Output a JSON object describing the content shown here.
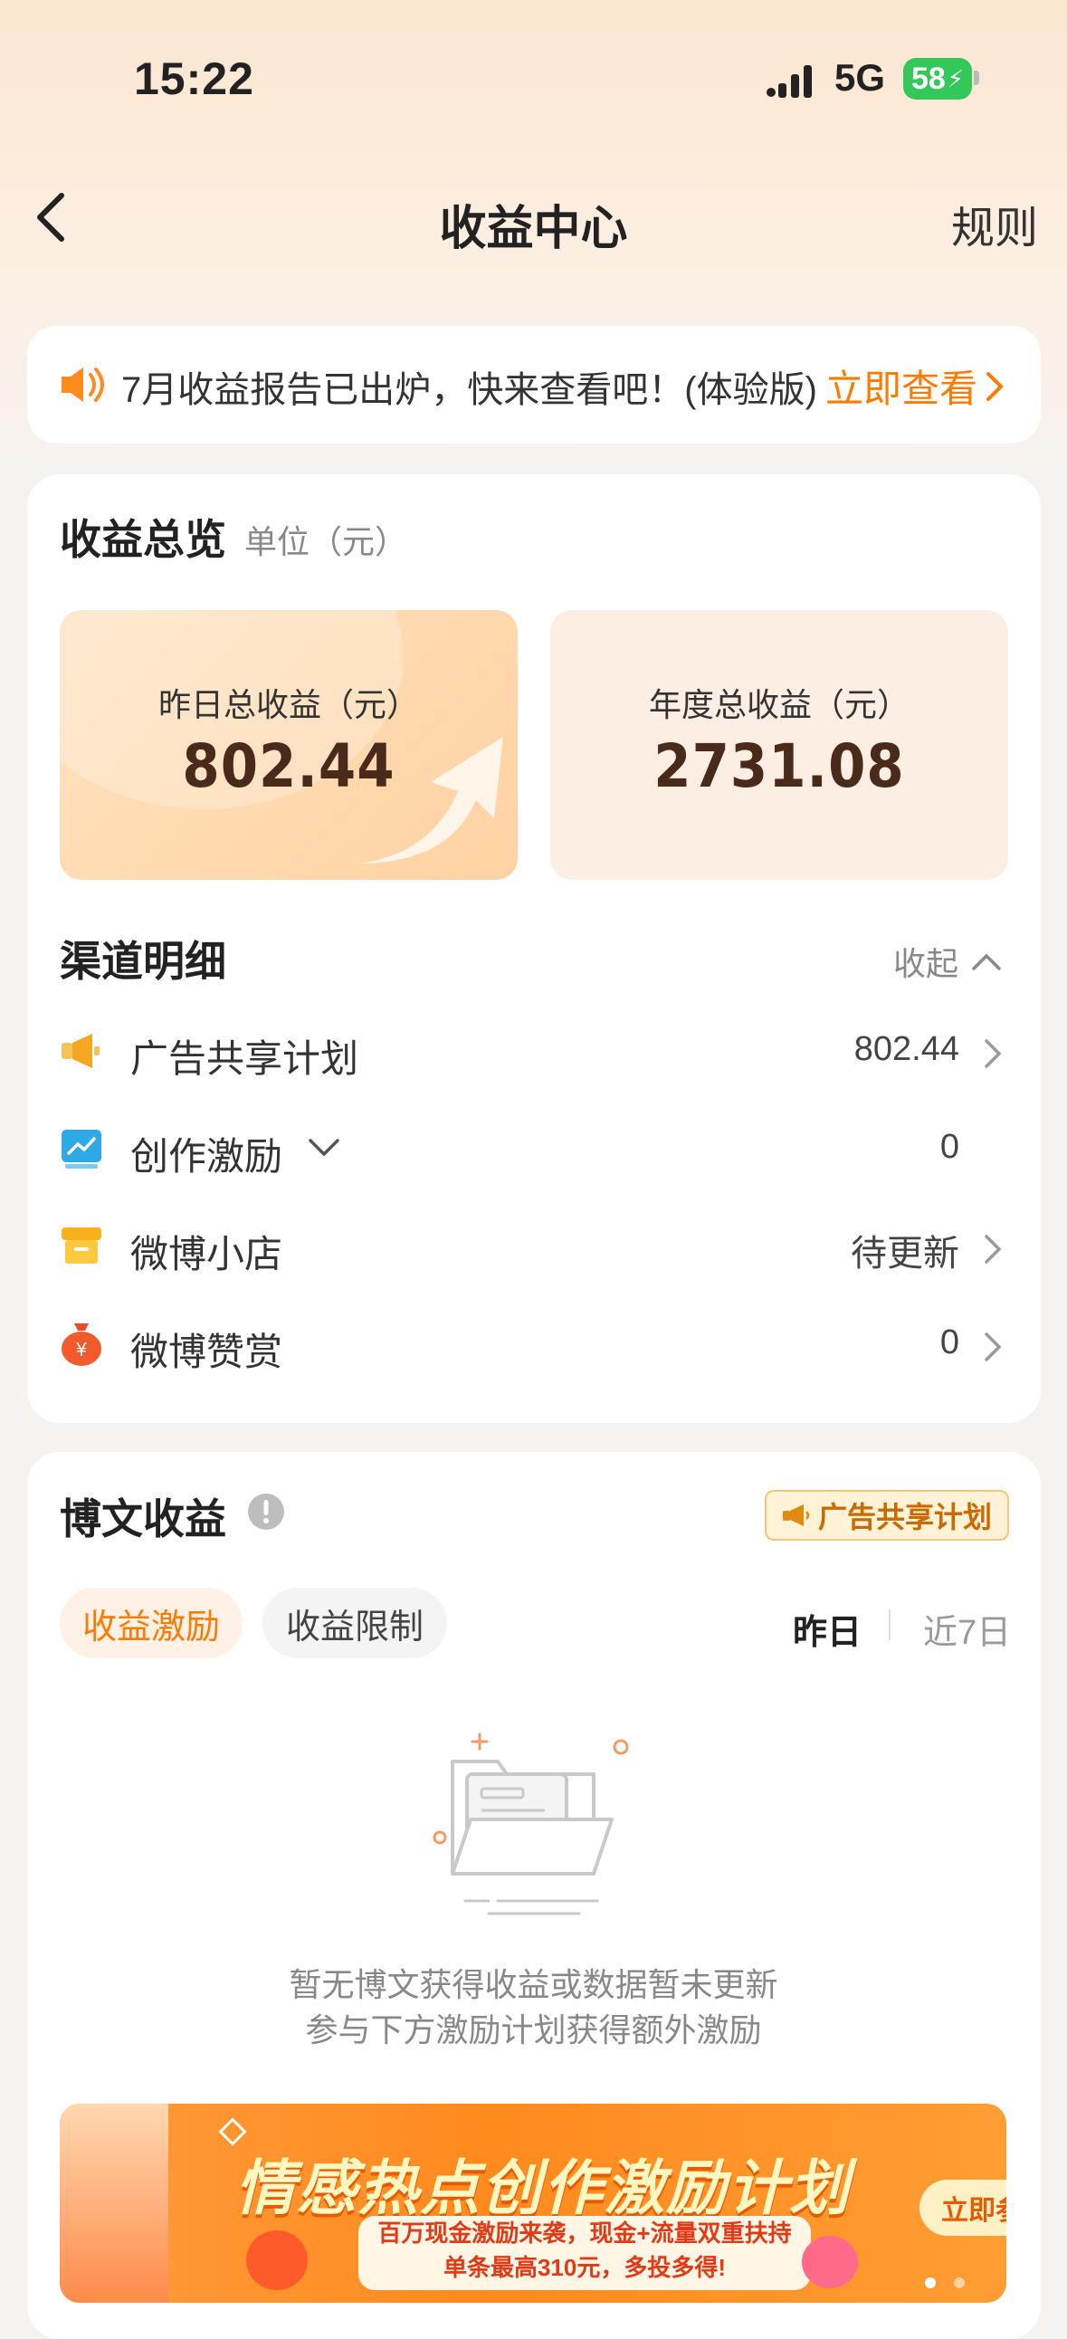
{
  "status": {
    "time": "15:22",
    "network": "5G",
    "battery": "58"
  },
  "nav": {
    "title": "收益中心",
    "rules": "规则"
  },
  "notice": {
    "text": "7月收益报告已出炉，快来查看吧！(体验版)",
    "cta": "立即查看"
  },
  "overview": {
    "title": "收益总览",
    "unit": "单位（元）",
    "yesterday_label": "昨日总收益（元）",
    "yesterday_value": "802.44",
    "year_label": "年度总收益（元）",
    "year_value": "2731.08"
  },
  "channels": {
    "title": "渠道明细",
    "collapse": "收起",
    "items": [
      {
        "label": "广告共享计划",
        "value": "802.44",
        "icon": "megaphone-icon"
      },
      {
        "label": "创作激励",
        "value": "0",
        "icon": "chart-icon"
      },
      {
        "label": "微博小店",
        "value": "待更新",
        "icon": "shop-icon"
      },
      {
        "label": "微博赞赏",
        "value": "0",
        "icon": "money-bag-icon"
      }
    ]
  },
  "posts": {
    "title": "博文收益",
    "badge": "广告共享计划",
    "tabs": [
      "收益激励",
      "收益限制"
    ],
    "periods": [
      "昨日",
      "近7日"
    ],
    "empty_line1": "暂无博文获得收益或数据暂未更新",
    "empty_line2": "参与下方激励计划获得额外激励"
  },
  "banner": {
    "title": "情感热点创作激励计划",
    "sub_line1": "百万现金激励来袭，现金+流量双重扶持",
    "sub_line2": "单条最高310元，多投多得!",
    "cta": "立即参"
  },
  "colors": {
    "accent": "#ff7a00",
    "battery": "#34c759"
  }
}
